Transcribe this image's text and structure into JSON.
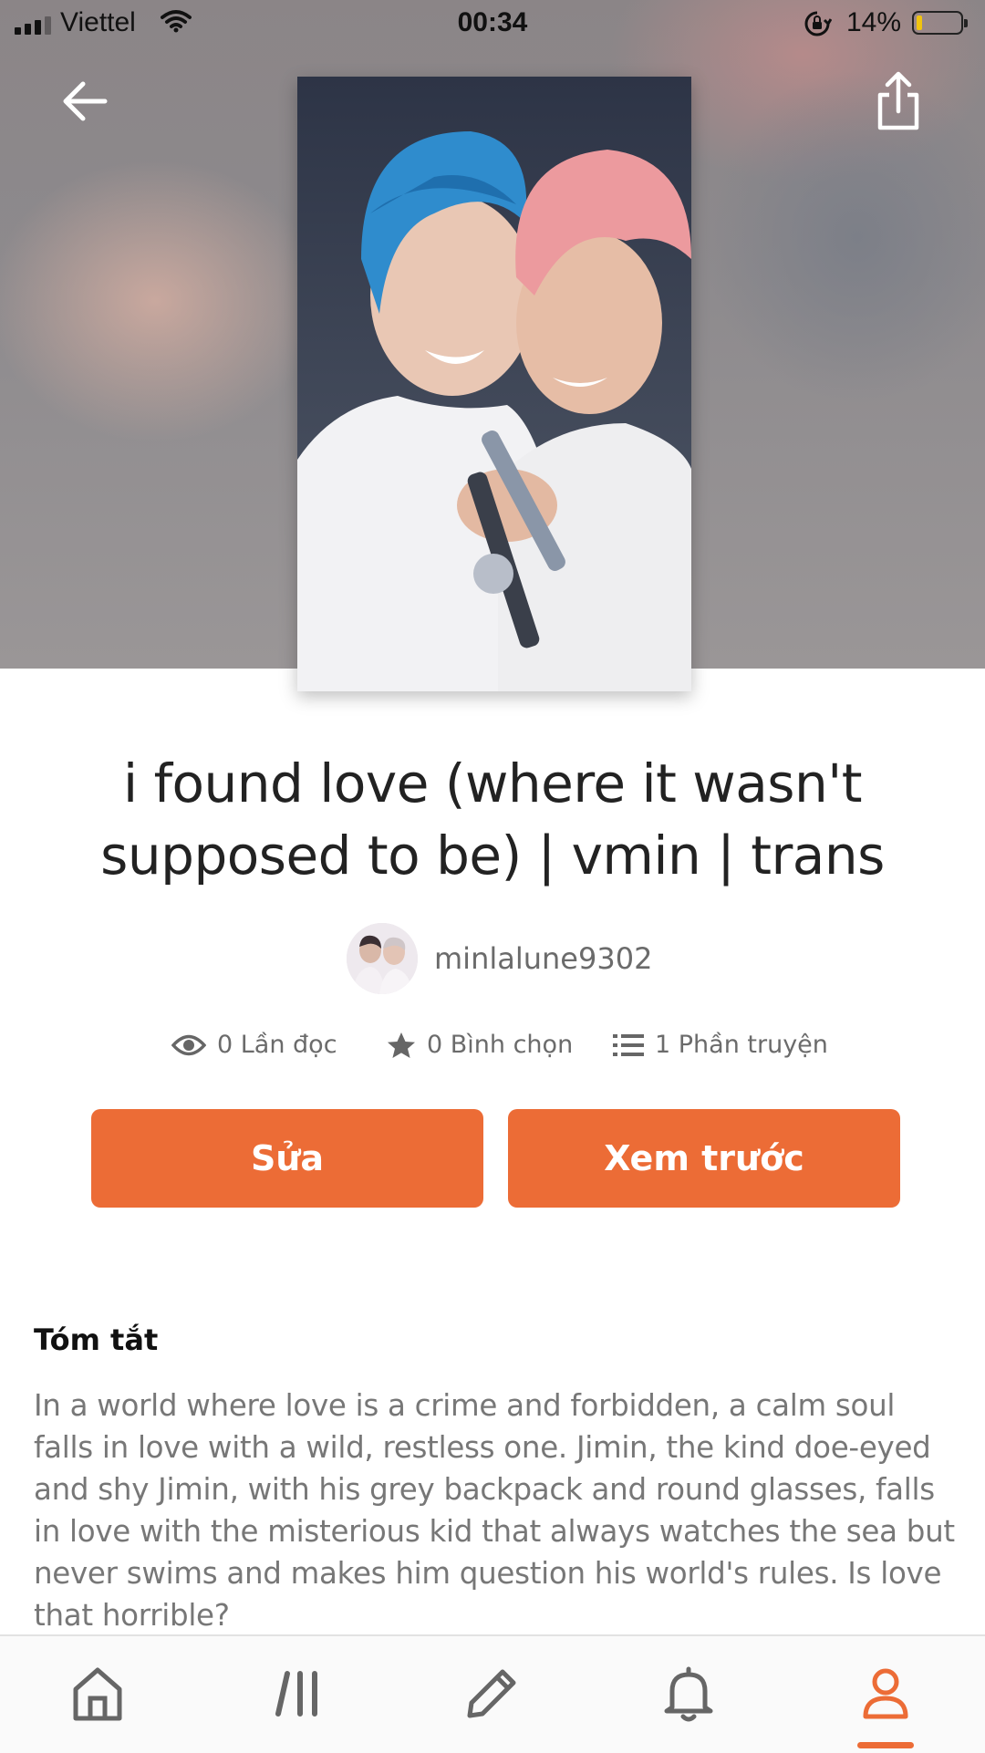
{
  "status_bar": {
    "carrier": "Viettel",
    "time": "00:34",
    "battery_percent": "14%",
    "battery_level": 0.14
  },
  "icons": {
    "back": "arrow-left-icon",
    "share": "share-icon",
    "reads": "eye-icon",
    "votes": "star-icon",
    "parts": "list-icon",
    "tabs": [
      "home-icon",
      "browse-icon",
      "pencil-icon",
      "bell-icon",
      "profile-icon"
    ]
  },
  "story": {
    "title": "i found love (where it wasn't supposed to be) | vmin | trans",
    "author": "minlalune9302",
    "reads": "0 Lần đọc",
    "votes": "0 Bình chọn",
    "parts": "1 Phần truyện"
  },
  "actions": {
    "edit_label": "Sửa",
    "preview_label": "Xem trước"
  },
  "summary": {
    "heading": "Tóm tắt",
    "text": "In a world where love is a crime and forbidden, a calm soul falls in love with a wild, restless one. Jimin, the kind doe-eyed and shy Jimin, with his grey backpack and round glasses, falls in love with the misterious kid that always watches the sea but never swims and makes him question his world's rules. Is love that horrible?"
  },
  "tabbar": {
    "active": "profile"
  },
  "colors": {
    "accent": "#ec6c36",
    "text": "#222222",
    "muted": "#777777"
  }
}
